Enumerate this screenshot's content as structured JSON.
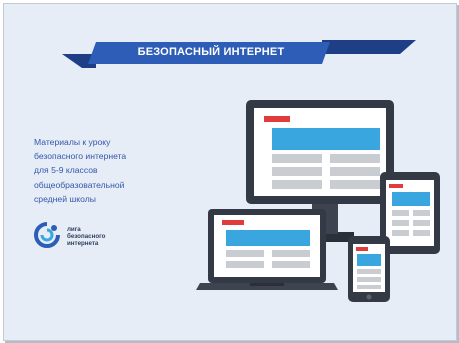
{
  "banner": {
    "title": "БЕЗОПАСНЫЙ ИНТЕРНЕТ"
  },
  "description": {
    "lines": [
      "Материалы к уроку",
      "безопасного интернета",
      "для 5-9 классов",
      "общеобразовательной",
      "средней школы"
    ]
  },
  "logo": {
    "lines": [
      "лига",
      "безопасного",
      "интернета"
    ]
  },
  "colors": {
    "background": "#e6edf7",
    "banner": "#2d5db6",
    "banner_dark": "#1e3f86",
    "text_blue": "#3557a8",
    "device_dark": "#333a45",
    "screen_blue": "#3aa6df",
    "accent_red": "#e23b3b",
    "placeholder_gray": "#c9ccd1"
  },
  "icons": [
    "desktop-monitor-icon",
    "laptop-icon",
    "tablet-icon",
    "smartphone-icon",
    "logo-mark-icon"
  ]
}
